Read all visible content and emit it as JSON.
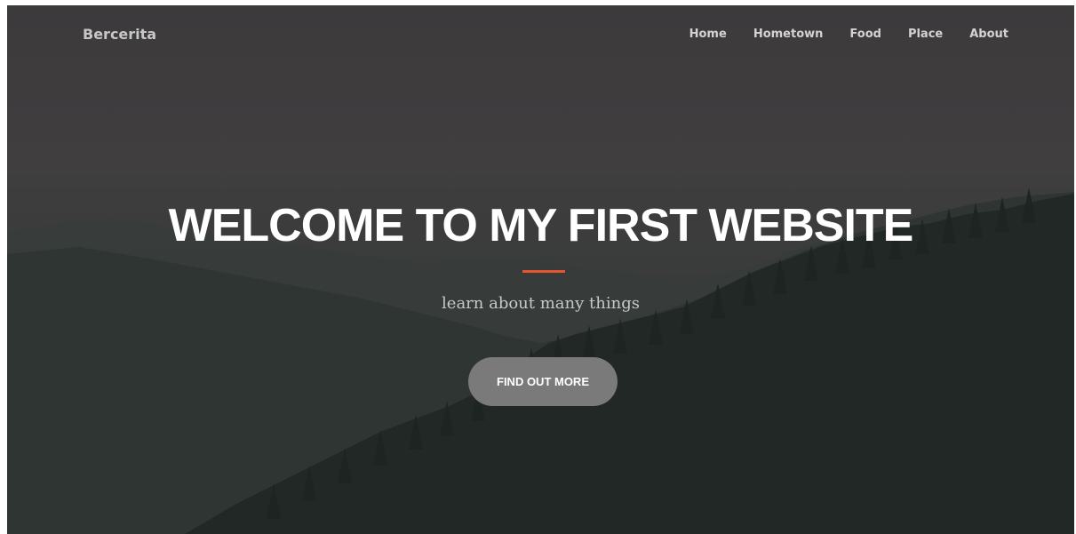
{
  "navbar": {
    "brand": "Bercerita",
    "links": [
      {
        "label": "Home"
      },
      {
        "label": "Hometown"
      },
      {
        "label": "Food"
      },
      {
        "label": "Place"
      },
      {
        "label": "About"
      }
    ]
  },
  "hero": {
    "headline": "WELCOME TO MY FIRST WEBSITE",
    "subhead": "learn about many things",
    "cta_label": "FIND OUT MORE"
  },
  "colors": {
    "accent": "#e4572e",
    "button": "#7b7a7b",
    "text": "#ffffff"
  }
}
